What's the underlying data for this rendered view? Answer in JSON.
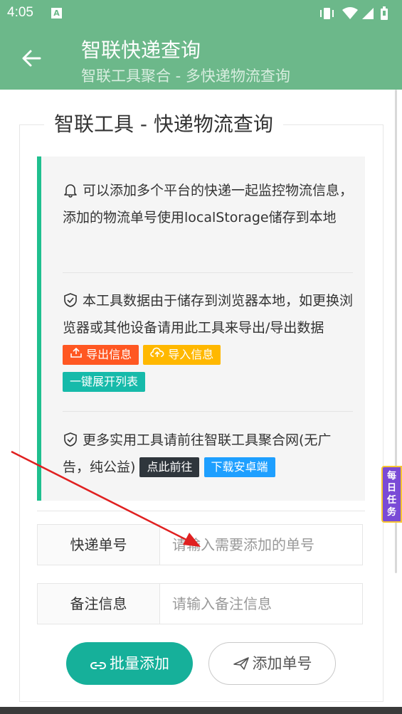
{
  "status_bar": {
    "time": "4:05",
    "notif_icon": "A"
  },
  "header": {
    "title": "智联快递查询",
    "subtitle": "智联工具聚合 - 多快递物流查询"
  },
  "panel": {
    "legend": "智联工具 - 快递物流查询",
    "notes": [
      {
        "icon": "bell-icon",
        "text": "可以添加多个平台的快递一起监控物流信息，添加的物流单号使用localStorage储存到本地"
      },
      {
        "icon": "shield-check-icon",
        "text": "本工具数据由于储存到浏览器本地，如更换浏览器或其他设备请用此工具来导出/导出数据"
      },
      {
        "icon": "shield-check-icon",
        "text": "更多实用工具请前往智联工具聚合网(无广告，纯公益)"
      }
    ],
    "tags": {
      "export": "导出信息",
      "import": "导入信息",
      "expand": "一键展开列表",
      "goto": "点此前往",
      "download": "下载安卓端"
    }
  },
  "form": {
    "tracking": {
      "label": "快递单号",
      "placeholder": "请输入需要添加的单号"
    },
    "remark": {
      "label": "备注信息",
      "placeholder": "请输入备注信息"
    },
    "batch_button": "批量添加",
    "add_button": "添加单号"
  },
  "floating": {
    "daily_task": "每日任务"
  },
  "colors": {
    "primary_green": "#6cb88a",
    "accent_teal": "#16baaa",
    "tag_orange": "#ff5722",
    "tag_yellow": "#ffb800",
    "tag_dark": "#2f363c",
    "tag_blue": "#1e9fff",
    "annotation_arrow": "#e02020"
  }
}
